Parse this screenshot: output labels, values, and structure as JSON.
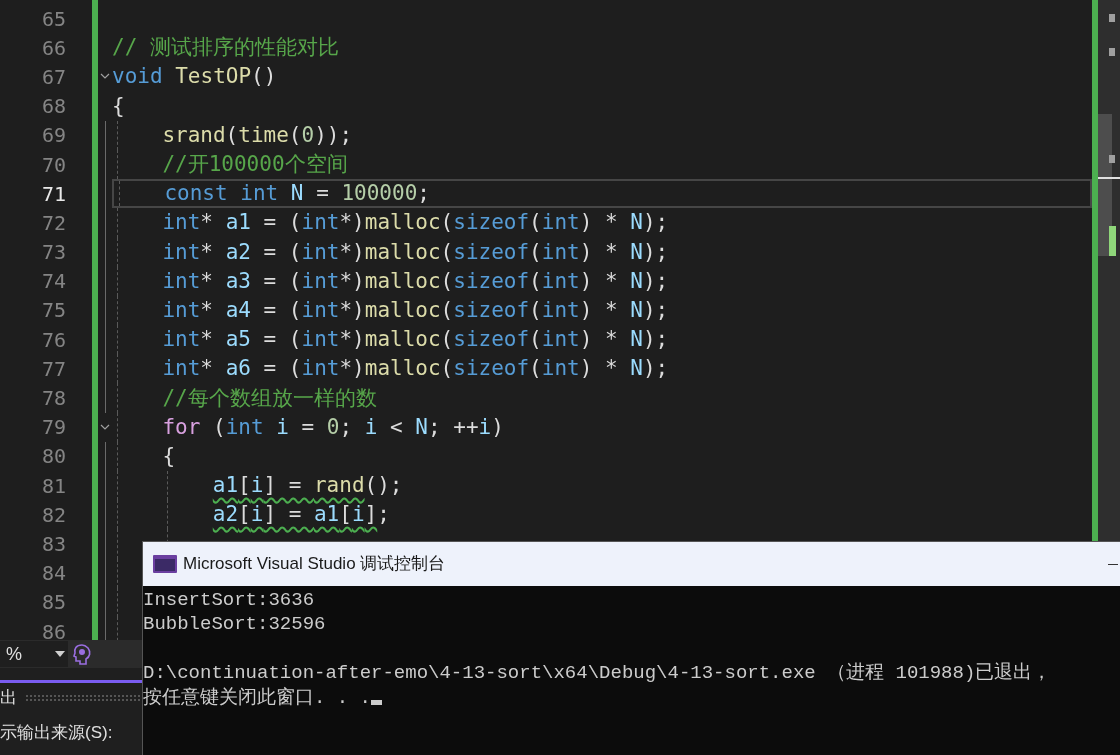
{
  "editor": {
    "lines": [
      {
        "number": "65",
        "current": false
      },
      {
        "number": "66",
        "current": false,
        "tokens": [
          {
            "text": "// 测试排序的性能对比",
            "kind": "comment"
          }
        ]
      },
      {
        "number": "67",
        "current": false,
        "expanded": true,
        "tokens": [
          {
            "text": "void ",
            "kind": "keyword"
          },
          {
            "text": "TestOP",
            "kind": "function"
          },
          {
            "text": "()",
            "kind": "plain"
          }
        ]
      },
      {
        "number": "68",
        "current": false,
        "tokens": [
          {
            "text": "{",
            "kind": "plain"
          }
        ],
        "children": [
          {
            "number": "69",
            "current": false,
            "tokens": [
              {
                "text": "srand",
                "kind": "function"
              },
              {
                "text": "(",
                "kind": "plain"
              },
              {
                "text": "time",
                "kind": "function"
              },
              {
                "text": "(",
                "kind": "plain"
              },
              {
                "text": "0",
                "kind": "number"
              },
              {
                "text": "));",
                "kind": "plain"
              }
            ]
          },
          {
            "number": "70",
            "current": false,
            "tokens": [
              {
                "text": "//开100000个空间",
                "kind": "comment"
              }
            ]
          },
          {
            "number": "71",
            "current": true,
            "tokens": [
              {
                "text": "const int ",
                "kind": "keyword"
              },
              {
                "text": "N",
                "kind": "variable"
              },
              {
                "text": " = ",
                "kind": "plain"
              },
              {
                "text": "100000",
                "kind": "number"
              },
              {
                "text": ";",
                "kind": "plain"
              }
            ]
          },
          {
            "number": "72",
            "current": false,
            "tokens": [
              {
                "text": "int",
                "kind": "keyword"
              },
              {
                "text": "* ",
                "kind": "plain"
              },
              {
                "text": "a1",
                "kind": "variable"
              },
              {
                "text": " = (",
                "kind": "plain"
              },
              {
                "text": "int",
                "kind": "keyword"
              },
              {
                "text": "*)",
                "kind": "plain"
              },
              {
                "text": "malloc",
                "kind": "function"
              },
              {
                "text": "(",
                "kind": "plain"
              },
              {
                "text": "sizeof",
                "kind": "keyword"
              },
              {
                "text": "(",
                "kind": "plain"
              },
              {
                "text": "int",
                "kind": "keyword"
              },
              {
                "text": ") * ",
                "kind": "plain"
              },
              {
                "text": "N",
                "kind": "variable"
              },
              {
                "text": ");",
                "kind": "plain"
              }
            ]
          },
          {
            "number": "73",
            "current": false,
            "tokens": [
              {
                "text": "int",
                "kind": "keyword"
              },
              {
                "text": "* ",
                "kind": "plain"
              },
              {
                "text": "a2",
                "kind": "variable"
              },
              {
                "text": " = (",
                "kind": "plain"
              },
              {
                "text": "int",
                "kind": "keyword"
              },
              {
                "text": "*)",
                "kind": "plain"
              },
              {
                "text": "malloc",
                "kind": "function"
              },
              {
                "text": "(",
                "kind": "plain"
              },
              {
                "text": "sizeof",
                "kind": "keyword"
              },
              {
                "text": "(",
                "kind": "plain"
              },
              {
                "text": "int",
                "kind": "keyword"
              },
              {
                "text": ") * ",
                "kind": "plain"
              },
              {
                "text": "N",
                "kind": "variable"
              },
              {
                "text": ");",
                "kind": "plain"
              }
            ]
          },
          {
            "number": "74",
            "current": false,
            "tokens": [
              {
                "text": "int",
                "kind": "keyword"
              },
              {
                "text": "* ",
                "kind": "plain"
              },
              {
                "text": "a3",
                "kind": "variable"
              },
              {
                "text": " = (",
                "kind": "plain"
              },
              {
                "text": "int",
                "kind": "keyword"
              },
              {
                "text": "*)",
                "kind": "plain"
              },
              {
                "text": "malloc",
                "kind": "function"
              },
              {
                "text": "(",
                "kind": "plain"
              },
              {
                "text": "sizeof",
                "kind": "keyword"
              },
              {
                "text": "(",
                "kind": "plain"
              },
              {
                "text": "int",
                "kind": "keyword"
              },
              {
                "text": ") * ",
                "kind": "plain"
              },
              {
                "text": "N",
                "kind": "variable"
              },
              {
                "text": ");",
                "kind": "plain"
              }
            ]
          },
          {
            "number": "75",
            "current": false,
            "tokens": [
              {
                "text": "int",
                "kind": "keyword"
              },
              {
                "text": "* ",
                "kind": "plain"
              },
              {
                "text": "a4",
                "kind": "variable"
              },
              {
                "text": " = (",
                "kind": "plain"
              },
              {
                "text": "int",
                "kind": "keyword"
              },
              {
                "text": "*)",
                "kind": "plain"
              },
              {
                "text": "malloc",
                "kind": "function"
              },
              {
                "text": "(",
                "kind": "plain"
              },
              {
                "text": "sizeof",
                "kind": "keyword"
              },
              {
                "text": "(",
                "kind": "plain"
              },
              {
                "text": "int",
                "kind": "keyword"
              },
              {
                "text": ") * ",
                "kind": "plain"
              },
              {
                "text": "N",
                "kind": "variable"
              },
              {
                "text": ");",
                "kind": "plain"
              }
            ]
          },
          {
            "number": "76",
            "current": false,
            "tokens": [
              {
                "text": "int",
                "kind": "keyword"
              },
              {
                "text": "* ",
                "kind": "plain"
              },
              {
                "text": "a5",
                "kind": "variable"
              },
              {
                "text": " = (",
                "kind": "plain"
              },
              {
                "text": "int",
                "kind": "keyword"
              },
              {
                "text": "*)",
                "kind": "plain"
              },
              {
                "text": "malloc",
                "kind": "function"
              },
              {
                "text": "(",
                "kind": "plain"
              },
              {
                "text": "sizeof",
                "kind": "keyword"
              },
              {
                "text": "(",
                "kind": "plain"
              },
              {
                "text": "int",
                "kind": "keyword"
              },
              {
                "text": ") * ",
                "kind": "plain"
              },
              {
                "text": "N",
                "kind": "variable"
              },
              {
                "text": ");",
                "kind": "plain"
              }
            ]
          },
          {
            "number": "77",
            "current": false,
            "tokens": [
              {
                "text": "int",
                "kind": "keyword"
              },
              {
                "text": "* ",
                "kind": "plain"
              },
              {
                "text": "a6",
                "kind": "variable"
              },
              {
                "text": " = (",
                "kind": "plain"
              },
              {
                "text": "int",
                "kind": "keyword"
              },
              {
                "text": "*)",
                "kind": "plain"
              },
              {
                "text": "malloc",
                "kind": "function"
              },
              {
                "text": "(",
                "kind": "plain"
              },
              {
                "text": "sizeof",
                "kind": "keyword"
              },
              {
                "text": "(",
                "kind": "plain"
              },
              {
                "text": "int",
                "kind": "keyword"
              },
              {
                "text": ") * ",
                "kind": "plain"
              },
              {
                "text": "N",
                "kind": "variable"
              },
              {
                "text": ");",
                "kind": "plain"
              }
            ]
          },
          {
            "number": "78",
            "current": false,
            "tokens": [
              {
                "text": "//每个数组放一样的数",
                "kind": "comment"
              }
            ]
          },
          {
            "number": "79",
            "current": false,
            "expanded": true,
            "tokens": [
              {
                "text": "for",
                "kind": "control"
              },
              {
                "text": " (",
                "kind": "plain"
              },
              {
                "text": "int ",
                "kind": "keyword"
              },
              {
                "text": "i",
                "kind": "variable"
              },
              {
                "text": " = ",
                "kind": "plain"
              },
              {
                "text": "0",
                "kind": "number"
              },
              {
                "text": "; ",
                "kind": "plain"
              },
              {
                "text": "i",
                "kind": "variable"
              },
              {
                "text": " < ",
                "kind": "plain"
              },
              {
                "text": "N",
                "kind": "variable"
              },
              {
                "text": "; ++",
                "kind": "plain"
              },
              {
                "text": "i",
                "kind": "variable"
              },
              {
                "text": ")",
                "kind": "plain"
              }
            ]
          },
          {
            "number": "80",
            "current": false,
            "tokens": [
              {
                "text": "{",
                "kind": "plain"
              }
            ],
            "children": [
              {
                "number": "81",
                "current": false,
                "tokens": [
                  {
                    "text": "a1",
                    "kind": "variable",
                    "squiggle": true
                  },
                  {
                    "text": "[",
                    "kind": "plain",
                    "squiggle": true
                  },
                  {
                    "text": "i",
                    "kind": "variable",
                    "squiggle": true
                  },
                  {
                    "text": "] = ",
                    "kind": "plain",
                    "squiggle": true
                  },
                  {
                    "text": "rand",
                    "kind": "function",
                    "squiggle": true
                  },
                  {
                    "text": "();",
                    "kind": "plain",
                    "squiggle": false
                  }
                ]
              },
              {
                "number": "82",
                "current": false,
                "tokens": [
                  {
                    "text": "a2",
                    "kind": "variable",
                    "squiggle": true
                  },
                  {
                    "text": "[",
                    "kind": "plain",
                    "squiggle": true
                  },
                  {
                    "text": "i",
                    "kind": "variable",
                    "squiggle": true
                  },
                  {
                    "text": "] = ",
                    "kind": "plain",
                    "squiggle": true
                  },
                  {
                    "text": "a1",
                    "kind": "variable",
                    "squiggle": true
                  },
                  {
                    "text": "[",
                    "kind": "plain",
                    "squiggle": true
                  },
                  {
                    "text": "i",
                    "kind": "variable",
                    "squiggle": true
                  },
                  {
                    "text": "]",
                    "kind": "plain",
                    "squiggle": true
                  },
                  {
                    "text": ";",
                    "kind": "plain",
                    "squiggle": false
                  }
                ]
              },
              {
                "number": "83",
                "current": false
              },
              {
                "number": "84",
                "current": false
              },
              {
                "number": "85",
                "current": false
              },
              {
                "number": "86",
                "current": false
              }
            ]
          }
        ]
      }
    ]
  },
  "bottom_panel": {
    "zoom_dropdown": {
      "value": "%"
    },
    "output_tab": {
      "label": "出"
    },
    "source_label": "示输出来源(S):"
  },
  "console": {
    "title": "Microsoft Visual Studio 调试控制台",
    "blocks": [
      [
        "InsertSort:3636",
        "BubbleSort:32596"
      ],
      [
        "D:\\continuation-after-emo\\4-13-sort\\x64\\Debug\\4-13-sort.exe （进程 101988)已退出，",
        "按任意键关闭此窗口. . ."
      ]
    ]
  }
}
